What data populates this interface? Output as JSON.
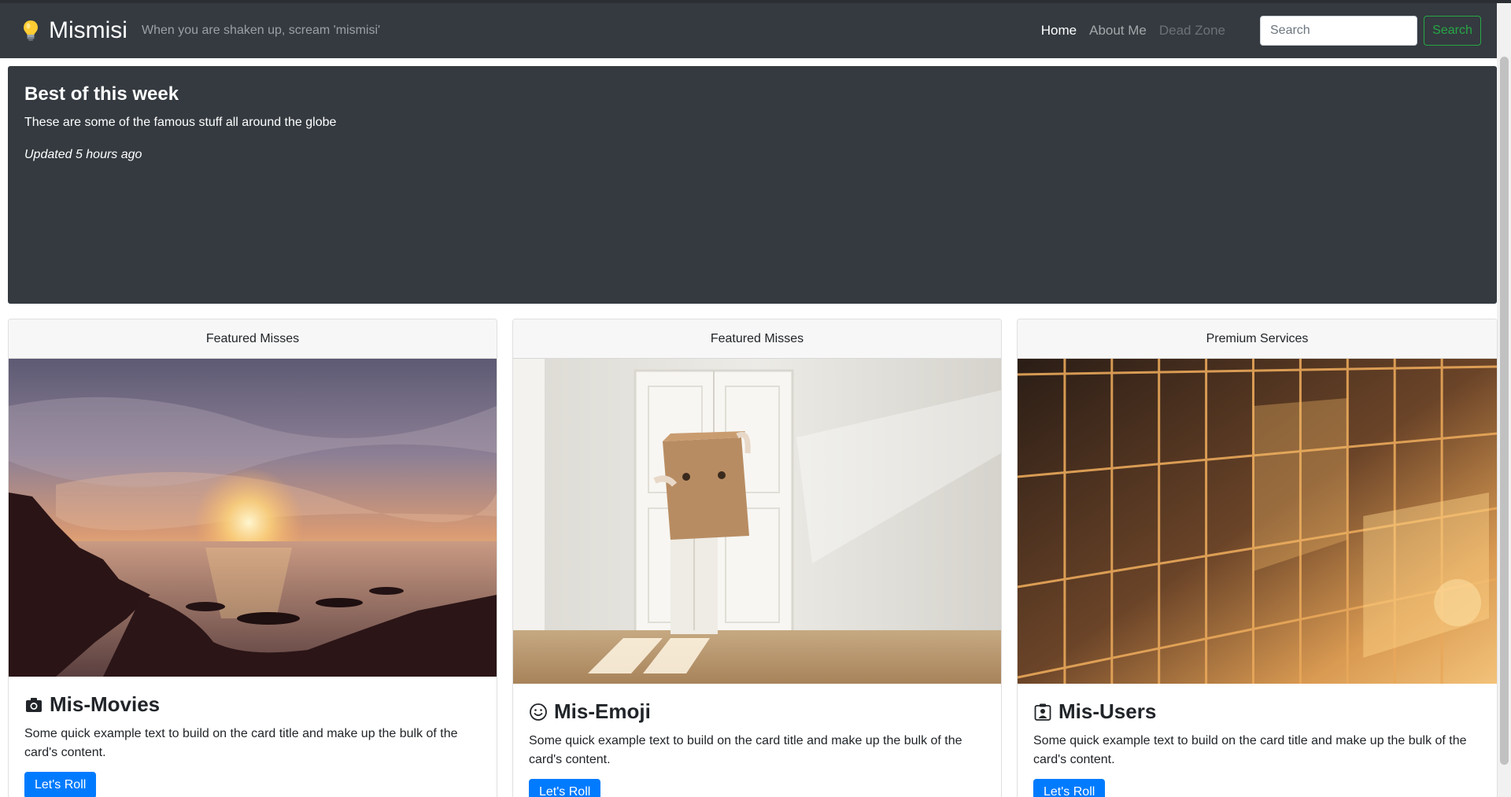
{
  "brand": {
    "icon": "lightbulb-icon",
    "name": "Mismisi",
    "tagline": "When you are shaken up, scream 'mismisi'"
  },
  "nav": {
    "items": [
      {
        "label": "Home",
        "state": "active"
      },
      {
        "label": "About Me",
        "state": "normal"
      },
      {
        "label": "Dead Zone",
        "state": "disabled"
      }
    ]
  },
  "search": {
    "placeholder": "Search",
    "button_label": "Search"
  },
  "jumbotron": {
    "title": "Best of this week",
    "text": "These are some of the famous stuff all around the globe",
    "updated": "Updated 5 hours ago"
  },
  "cards": [
    {
      "header": "Featured Misses",
      "image": "sunset-over-rocky-coast",
      "icon": "camera-icon",
      "title": "Mis-Movies",
      "text": "Some quick example text to build on the card title and make up the bulk of the card's content.",
      "button": "Let's Roll"
    },
    {
      "header": "Featured Misses",
      "image": "person-with-cardboard-box-head",
      "icon": "smiley-icon",
      "title": "Mis-Emoji",
      "text": "Some quick example text to build on the card title and make up the bulk of the card's content.",
      "button": "Let's Roll"
    },
    {
      "header": "Premium Services",
      "image": "glass-building-facade-sunset",
      "icon": "person-badge-icon",
      "title": "Mis-Users",
      "text": "Some quick example text to build on the card title and make up the bulk of the card's content.",
      "button": "Let's Roll"
    }
  ],
  "colors": {
    "navbar": "#343a40",
    "primary": "#007bff",
    "success": "#28a745"
  }
}
